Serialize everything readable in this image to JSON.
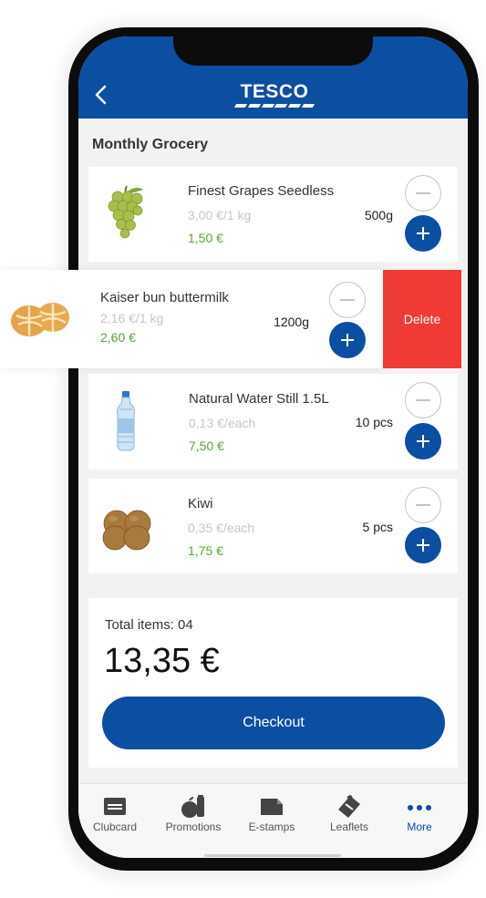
{
  "header": {
    "logo_text": "TESCO"
  },
  "list_title": "Monthly Grocery",
  "items": [
    {
      "name": "Finest Grapes Seedless",
      "unit_price": "3,00 €/1 kg",
      "total": "1,50 €",
      "quantity": "500g"
    },
    {
      "name": "Kaiser bun buttermilk",
      "unit_price": "2,16 €/1 kg",
      "total": "2,60 €",
      "quantity": "1200g"
    },
    {
      "name": "Natural Water Still 1.5L",
      "unit_price": "0,13 €/each",
      "total": "7,50 €",
      "quantity": "10 pcs"
    },
    {
      "name": "Kiwi",
      "unit_price": "0,35 €/each",
      "total": "1,75 €",
      "quantity": "5 pcs"
    }
  ],
  "swipe_action": {
    "label": "Delete",
    "color": "#ef3a36"
  },
  "summary": {
    "items_label": "Total items: 04",
    "amount": "13,35 €",
    "checkout_label": "Checkout"
  },
  "tabs": [
    {
      "label": "Clubcard",
      "icon": "clubcard-icon",
      "active": false
    },
    {
      "label": "Promotions",
      "icon": "promotions-icon",
      "active": false
    },
    {
      "label": "E-stamps",
      "icon": "e-stamps-icon",
      "active": false
    },
    {
      "label": "Leaflets",
      "icon": "leaflets-icon",
      "active": false
    },
    {
      "label": "More",
      "icon": "more-icon",
      "active": true
    }
  ],
  "colors": {
    "brand_blue": "#0b4ea2",
    "price_green": "#58a832",
    "delete_red": "#ef3a36"
  }
}
